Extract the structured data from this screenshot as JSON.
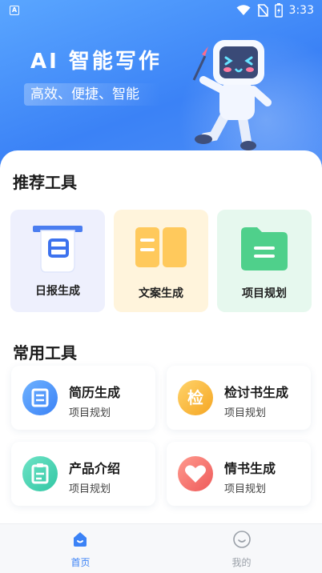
{
  "statusbar": {
    "time": "3:33",
    "app_badge": "A"
  },
  "hero": {
    "title": "AI 智能写作",
    "subtitle": "高效、便捷、智能"
  },
  "recommended": {
    "title": "推荐工具",
    "items": [
      {
        "label": "日报生成",
        "icon": "daily-report-icon",
        "bg": "#eef0fd"
      },
      {
        "label": "文案生成",
        "icon": "book-icon",
        "bg": "#fff4dc"
      },
      {
        "label": "项目规划",
        "icon": "folder-icon",
        "bg": "#e6f8ee"
      }
    ]
  },
  "common": {
    "title": "常用工具",
    "items": [
      {
        "title": "简历生成",
        "subtitle": "项目规划",
        "icon": "resume-icon",
        "color": "#3b8ef6"
      },
      {
        "title": "检讨书生成",
        "subtitle": "项目规划",
        "icon": "check-icon",
        "glyph": "检",
        "color": "#f7b42c"
      },
      {
        "title": "产品介绍",
        "subtitle": "项目规划",
        "icon": "clipboard-icon",
        "color": "#3fcfb1"
      },
      {
        "title": "情书生成",
        "subtitle": "项目规划",
        "icon": "heart-icon",
        "color": "#f06e6e"
      }
    ]
  },
  "tabbar": {
    "items": [
      {
        "label": "首页",
        "icon": "home-icon",
        "active": true
      },
      {
        "label": "我的",
        "icon": "profile-icon",
        "active": false
      }
    ],
    "active_color": "#3b82f6",
    "inactive_color": "#9aa0a8"
  }
}
